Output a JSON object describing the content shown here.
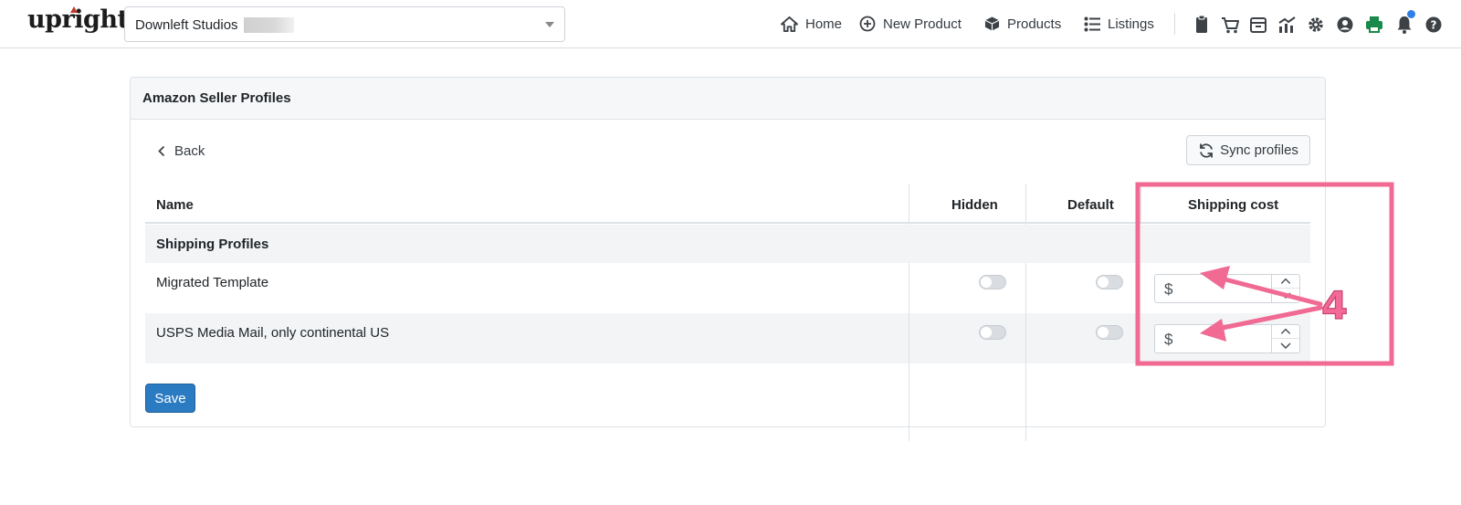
{
  "navbar": {
    "logo_text": "upright",
    "store_select": {
      "value": "Downleft Studios"
    },
    "links": [
      {
        "label": "Home",
        "icon": "home-icon"
      },
      {
        "label": "New Product",
        "icon": "plus-circle-icon"
      },
      {
        "label": "Products",
        "icon": "box-icon"
      },
      {
        "label": "Listings",
        "icon": "list-icon"
      }
    ],
    "tool_icons": [
      "clipboard-icon",
      "cart-icon",
      "store-icon",
      "chart-icon",
      "gear-icon",
      "user-circle-icon",
      "printer-icon",
      "bell-icon",
      "help-icon"
    ],
    "colors": {
      "printer": "#1a8a4a",
      "notification_dot": "#2f7fe6"
    }
  },
  "card": {
    "title": "Amazon Seller Profiles",
    "back_label": "Back",
    "sync_label": "Sync profiles",
    "table": {
      "columns": [
        "Name",
        "Hidden",
        "Default",
        "Shipping cost"
      ],
      "group_label": "Shipping Profiles",
      "rows": [
        {
          "name": "Migrated Template",
          "hidden": false,
          "default": false,
          "currency": "$",
          "cost": ""
        },
        {
          "name": "USPS Media Mail, only continental US",
          "hidden": false,
          "default": false,
          "currency": "$",
          "cost": ""
        }
      ]
    },
    "save_label": "Save",
    "save_color": "#2b7bc2"
  },
  "annotation": {
    "label": "4",
    "color": "#f36a96"
  }
}
